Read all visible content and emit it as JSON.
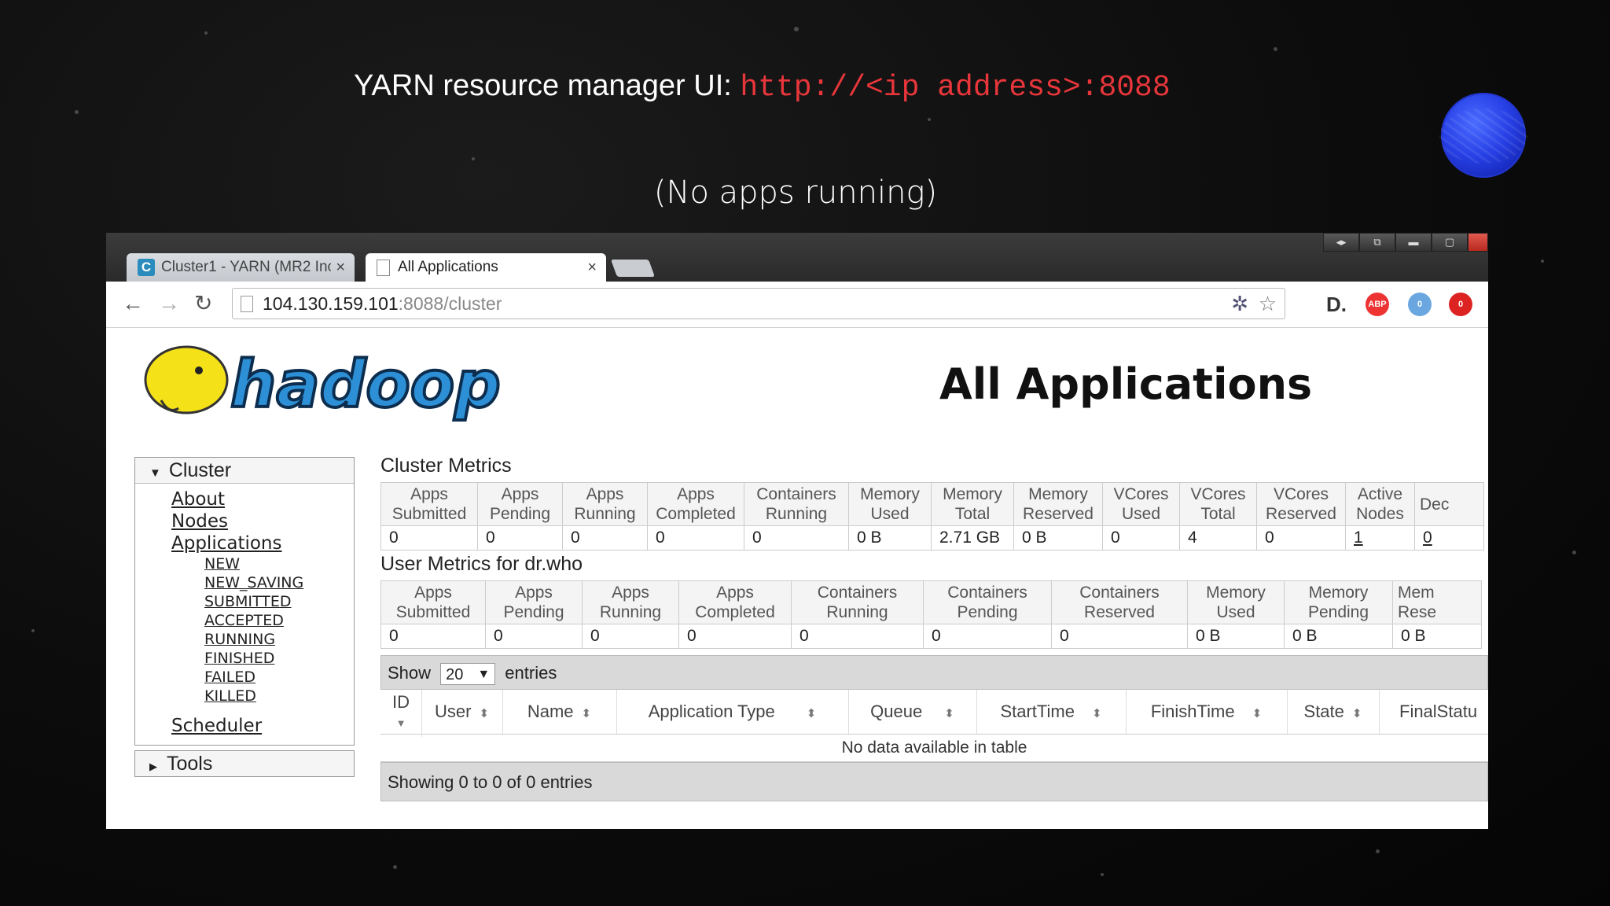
{
  "slide": {
    "title_prefix": "YARN resource manager UI: ",
    "title_url": "http://<ip address>:8088",
    "subtitle": "(No apps running)"
  },
  "browser": {
    "tabs": [
      {
        "label": "Cluster1 - YARN (MR2 Inc",
        "icon": "c-favicon-icon",
        "active": false
      },
      {
        "label": "All Applications",
        "icon": "page-icon",
        "active": true
      }
    ],
    "url_host": "104.130.159.101",
    "url_rest": ":8088/cluster",
    "extensions": [
      "D.",
      "ABP",
      "0",
      "0"
    ]
  },
  "page": {
    "logo_text": "hadoop",
    "title": "All Applications",
    "sidebar": {
      "cluster_label": "Cluster",
      "links": [
        "About",
        "Nodes",
        "Applications"
      ],
      "app_states": [
        "NEW",
        "NEW_SAVING",
        "SUBMITTED",
        "ACCEPTED",
        "RUNNING",
        "FINISHED",
        "FAILED",
        "KILLED"
      ],
      "scheduler_label": "Scheduler",
      "tools_label": "Tools"
    },
    "cluster_metrics": {
      "title": "Cluster Metrics",
      "headers": [
        [
          "Apps",
          "Submitted"
        ],
        [
          "Apps",
          "Pending"
        ],
        [
          "Apps",
          "Running"
        ],
        [
          "Apps",
          "Completed"
        ],
        [
          "Containers",
          "Running"
        ],
        [
          "Memory",
          "Used"
        ],
        [
          "Memory",
          "Total"
        ],
        [
          "Memory",
          "Reserved"
        ],
        [
          "VCores",
          "Used"
        ],
        [
          "VCores",
          "Total"
        ],
        [
          "VCores",
          "Reserved"
        ],
        [
          "Active",
          "Nodes"
        ],
        [
          "Dec",
          ""
        ]
      ],
      "values": [
        "0",
        "0",
        "0",
        "0",
        "0",
        "0 B",
        "2.71 GB",
        "0 B",
        "0",
        "4",
        "0",
        "1",
        "0"
      ]
    },
    "user_metrics": {
      "title": "User Metrics for dr.who",
      "headers": [
        [
          "Apps",
          "Submitted"
        ],
        [
          "Apps",
          "Pending"
        ],
        [
          "Apps",
          "Running"
        ],
        [
          "Apps",
          "Completed"
        ],
        [
          "Containers",
          "Running"
        ],
        [
          "Containers",
          "Pending"
        ],
        [
          "Containers",
          "Reserved"
        ],
        [
          "Memory",
          "Used"
        ],
        [
          "Memory",
          "Pending"
        ],
        [
          "Mem",
          "Rese"
        ]
      ],
      "values": [
        "0",
        "0",
        "0",
        "0",
        "0",
        "0",
        "0",
        "0 B",
        "0 B",
        "0 B"
      ]
    },
    "apps_table": {
      "show_label": "Show",
      "page_size": "20",
      "entries_label": "entries",
      "columns": [
        "ID",
        "User",
        "Name",
        "Application Type",
        "Queue",
        "StartTime",
        "FinishTime",
        "State",
        "FinalStatu"
      ],
      "empty_text": "No data available in table",
      "footer": "Showing 0 to 0 of 0 entries"
    }
  }
}
